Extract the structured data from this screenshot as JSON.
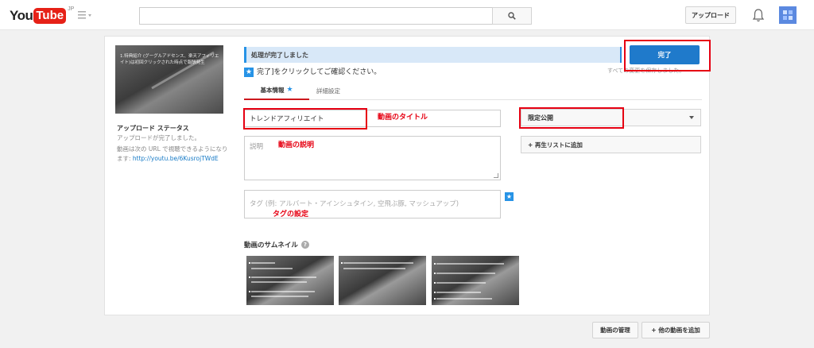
{
  "header": {
    "logo_you": "You",
    "logo_tube": "Tube",
    "logo_region": "JP",
    "upload_label": "アップロード",
    "brand_red": "#e62117"
  },
  "sidebar": {
    "thumbnail_text": "1.特典紹介 (グーグルアドセンス、楽天アフィリエイト)は初回クリックされた時点で報酬発生",
    "status_title": "アップロード ステータス",
    "status_message": "アップロードが完了しました。",
    "url_prefix": "動画は次の URL で視聴できるようになります:",
    "url": "http://youtu.be/6KusrojTWdE"
  },
  "main": {
    "processing_message": "処理が完了しました",
    "done_label": "完了",
    "all_changes_text": "すべての変更を保存しました。",
    "confirm_text": "完了]をクリックしてご確認ください。",
    "tabs": [
      {
        "label": "基本情報"
      },
      {
        "label": "詳細設定"
      }
    ],
    "title_value": "トレンドアフィリエイト",
    "description_placeholder": "説明",
    "tags_placeholder": "タグ (例: アルバート・アインシュタイン, 空飛ぶ豚, マッシュアップ)",
    "privacy_value": "限定公開",
    "playlist_label": "+ 再生リストに追加",
    "thumbnails_label": "動画のサムネイル",
    "accent_blue": "#1f7acb"
  },
  "annotations": {
    "title_note": "動画のタイトル",
    "desc_note": "動画の説明",
    "tags_note": "タグの設定",
    "color": "#e60012"
  },
  "footer": {
    "manage_label": "動画の管理",
    "add_more_label": "+ 他の動画を追加"
  }
}
